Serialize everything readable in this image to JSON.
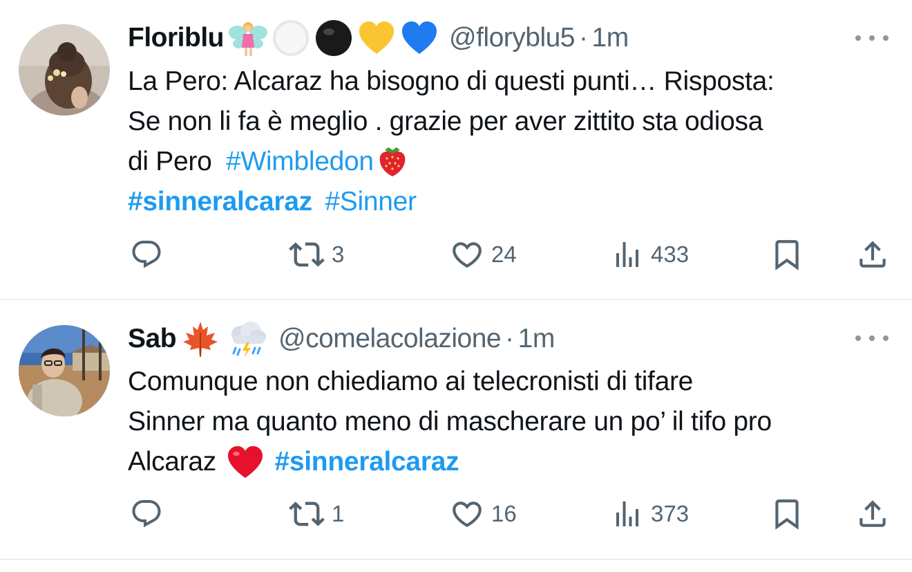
{
  "tweets": [
    {
      "name": "Floriblu",
      "handle": "@floryblu5",
      "separator": "·",
      "time": "1m",
      "text_line1": "La Pero: Alcaraz ha bisogno di questi punti… Risposta:",
      "text_line2": "Se non li fa è meglio . grazie per aver zittito sta odiosa",
      "text_line3_pre": "di Pero ",
      "hashtag_wimbledon": "#Wimbledon",
      "hashtag_sinneralcaraz": "#sinneralcaraz",
      "hashtag_sinner": "#Sinner",
      "replies": "",
      "retweets": "3",
      "likes": "24",
      "views": "433"
    },
    {
      "name": "Sab",
      "handle": "@comelacolazione",
      "separator": "·",
      "time": "1m",
      "text_line1": "Comunque non chiediamo ai telecronisti di tifare",
      "text_line2": "Sinner ma quanto meno di mascherare un po’ il tifo pro",
      "text_line3_pre": "Alcaraz ",
      "hashtag_sinneralcaraz": "#sinneralcaraz",
      "replies": "",
      "retweets": "1",
      "likes": "16",
      "views": "373"
    }
  ],
  "icons": {
    "reply": "reply-icon",
    "retweet": "retweet-icon",
    "like": "heart-icon",
    "views": "views-chart-icon",
    "bookmark": "bookmark-icon",
    "share": "share-icon",
    "more": "more-icon"
  },
  "colors": {
    "link": "#1d9bf0",
    "secondary_text": "#536471",
    "primary_text": "#0f1419"
  }
}
